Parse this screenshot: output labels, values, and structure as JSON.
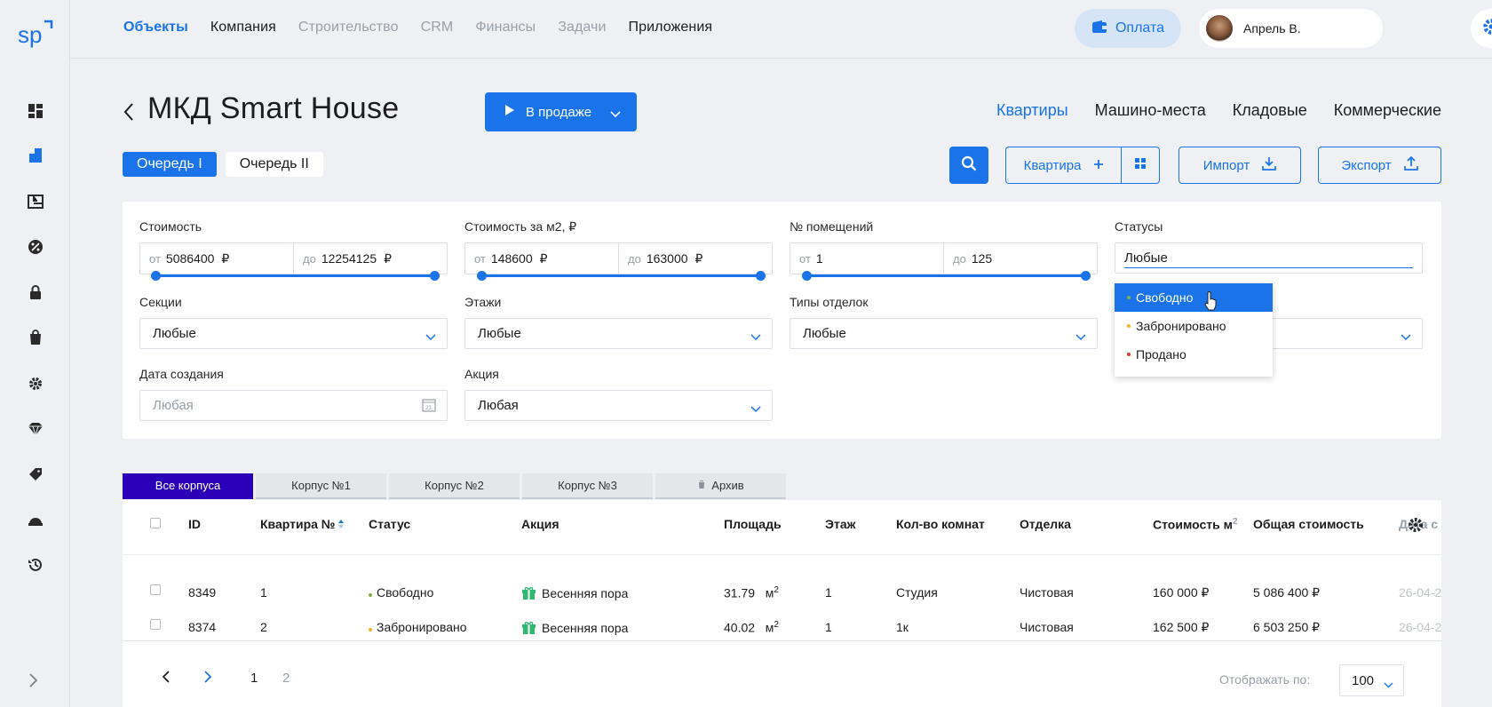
{
  "sidebar": {
    "logo": "sp",
    "icons": [
      "dashboard-icon",
      "building-icon",
      "plan-icon",
      "percent-icon",
      "lock-icon",
      "bag-icon",
      "gears-icon",
      "diamond-icon",
      "tag-icon",
      "helmet-icon",
      "history-icon"
    ],
    "expand_icon": "chevron-right-icon"
  },
  "topnav": {
    "items": [
      "Объекты",
      "Компания",
      "Строительство",
      "CRM",
      "Финансы",
      "Задачи",
      "Приложения"
    ],
    "active": "Объекты"
  },
  "payment": {
    "label": "Оплата"
  },
  "user": {
    "name": "Апрель В."
  },
  "page": {
    "title": "МКД Smart House",
    "status_button": "В продаже"
  },
  "types": {
    "items": [
      "Квартиры",
      "Машино-места",
      "Кладовые",
      "Коммерческие"
    ],
    "active": "Квартиры"
  },
  "queues": {
    "items": [
      "Очередь I",
      "Очередь II"
    ],
    "active": "Очередь I"
  },
  "actions": {
    "add": "Квартира",
    "import": "Импорт",
    "export": "Экспорт"
  },
  "filters": {
    "cost": {
      "label": "Стоимость",
      "from_prefix": "от",
      "from": "5086400",
      "to_prefix": "до",
      "to": "12254125",
      "currency": "₽"
    },
    "cost_m2": {
      "label": "Стоимость за м2, ₽",
      "from_prefix": "от",
      "from": "148600",
      "to_prefix": "до",
      "to": "163000",
      "currency": "₽"
    },
    "rooms": {
      "label": "№ помещений",
      "from_prefix": "от",
      "from": "1",
      "to_prefix": "до",
      "to": "125"
    },
    "statuses": {
      "label": "Статусы",
      "value": "Любые",
      "options": [
        {
          "label": "Свободно",
          "color": "#7cb342"
        },
        {
          "label": "Забронировано",
          "color": "#f2b81e"
        },
        {
          "label": "Продано",
          "color": "#e53935"
        }
      ],
      "highlighted": "Свободно"
    },
    "sections": {
      "label": "Секции",
      "value": "Любые"
    },
    "floors": {
      "label": "Этажи",
      "value": "Любые"
    },
    "finish_types": {
      "label": "Типы отделок",
      "value": "Любые"
    },
    "created": {
      "label": "Дата создания",
      "placeholder": "Любая"
    },
    "promo": {
      "label": "Акция",
      "value": "Любая"
    }
  },
  "building_tabs": {
    "items": [
      "Все корпуса",
      "Корпус №1",
      "Корпус №2",
      "Корпус №3",
      "Архив"
    ],
    "active": "Все корпуса"
  },
  "table": {
    "headers": [
      "ID",
      "Квартира №",
      "Статус",
      "Акция",
      "Площадь",
      "Этаж",
      "Кол-во комнат",
      "Отделка",
      "Стоимость м",
      "Общая стоимость",
      "Дата с"
    ],
    "rows": [
      {
        "id": "8349",
        "apt": "1",
        "status": "Свободно",
        "status_color": "#7cb342",
        "promo": "Весенняя пора",
        "area": "31.79",
        "area_unit": "м",
        "floor": "1",
        "rooms": "Студия",
        "finish": "Чистовая",
        "cost_m2": "160 000 ₽",
        "total": "5 086 400 ₽",
        "date": "26-04-2"
      },
      {
        "id": "8374",
        "apt": "2",
        "status": "Забронировано",
        "status_color": "#f2b81e",
        "promo": "Весенняя пора",
        "area": "40.02",
        "area_unit": "м",
        "floor": "1",
        "rooms": "1к",
        "finish": "Чистовая",
        "cost_m2": "162 500 ₽",
        "total": "6 503 250 ₽",
        "date": "26-04-2"
      }
    ]
  },
  "pagination": {
    "pages": [
      "1",
      "2"
    ],
    "per_page_label": "Отображать по:",
    "per_page": "100"
  },
  "colors": {
    "accent": "#1a73e8",
    "tab_active": "#2a00b8"
  }
}
